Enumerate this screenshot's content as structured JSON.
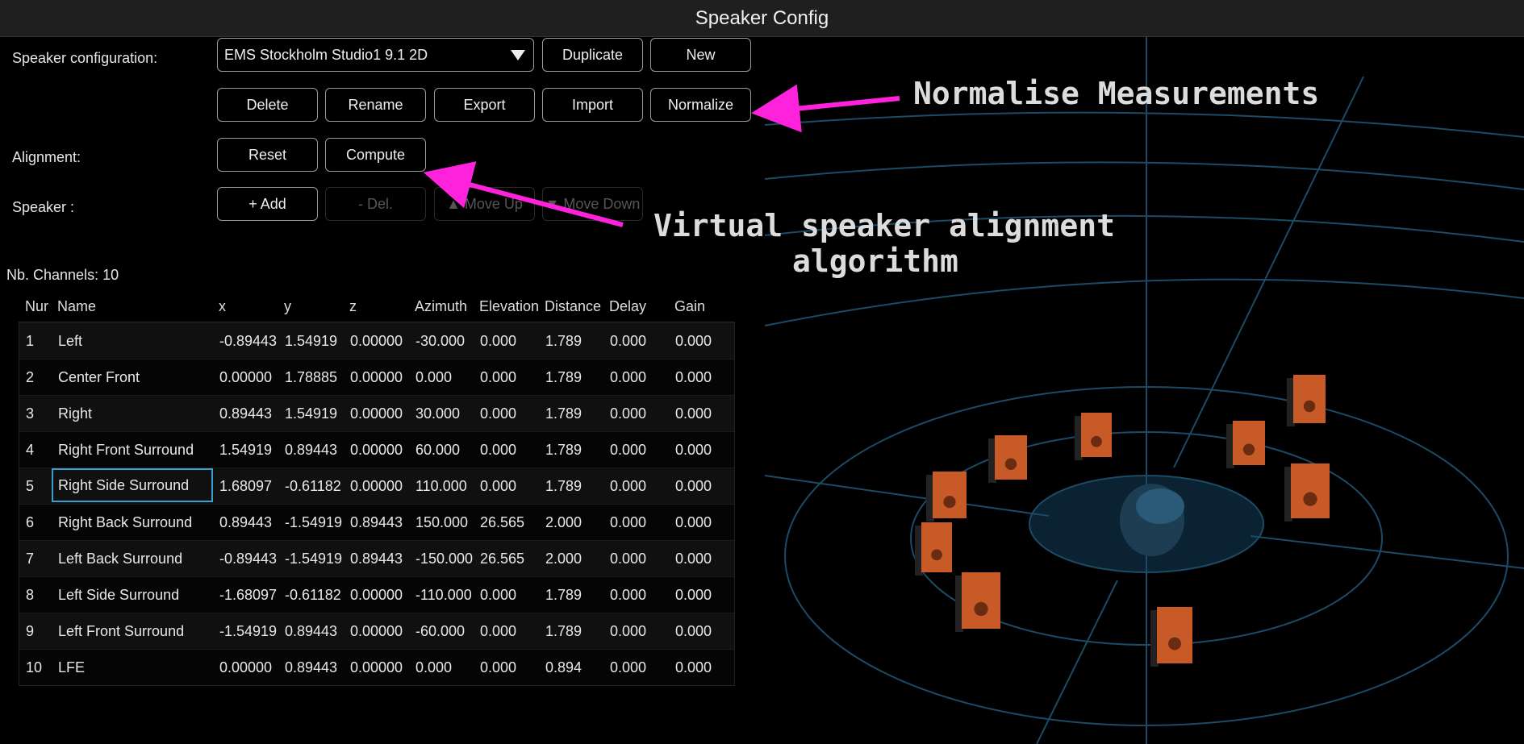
{
  "window": {
    "title": "Speaker Config"
  },
  "config": {
    "label": "Speaker configuration:",
    "selected": "EMS Stockholm Studio1 9.1 2D",
    "buttons": {
      "duplicate": "Duplicate",
      "new": "New",
      "delete": "Delete",
      "rename": "Rename",
      "export": "Export",
      "import": "Import",
      "normalize": "Normalize"
    }
  },
  "alignment": {
    "label": "Alignment:",
    "reset": "Reset",
    "compute": "Compute"
  },
  "speaker": {
    "label": "Speaker :",
    "add": "+ Add",
    "del": "- Del.",
    "move_up": "▲ Move Up",
    "move_down": "▼ Move Down"
  },
  "channels": {
    "label": "Nb. Channels: 10"
  },
  "table": {
    "headers": [
      "Nur",
      "Name",
      "x",
      "y",
      "z",
      "Azimuth",
      "Elevation",
      "Distance",
      "Delay",
      "Gain"
    ],
    "rows": [
      [
        "1",
        "Left",
        "-0.89443",
        "1.54919",
        "0.00000",
        "-30.000",
        "0.000",
        "1.789",
        "0.000",
        "0.000"
      ],
      [
        "2",
        "Center Front",
        "0.00000",
        "1.78885",
        "0.00000",
        "0.000",
        "0.000",
        "1.789",
        "0.000",
        "0.000"
      ],
      [
        "3",
        "Right",
        "0.89443",
        "1.54919",
        "0.00000",
        "30.000",
        "0.000",
        "1.789",
        "0.000",
        "0.000"
      ],
      [
        "4",
        "Right Front Surround",
        "1.54919",
        "0.89443",
        "0.00000",
        "60.000",
        "0.000",
        "1.789",
        "0.000",
        "0.000"
      ],
      [
        "5",
        "Right Side Surround",
        "1.68097",
        "-0.61182",
        "0.00000",
        "110.000",
        "0.000",
        "1.789",
        "0.000",
        "0.000"
      ],
      [
        "6",
        "Right Back Surround",
        "0.89443",
        "-1.54919",
        "0.89443",
        "150.000",
        "26.565",
        "2.000",
        "0.000",
        "0.000"
      ],
      [
        "7",
        "Left Back Surround",
        "-0.89443",
        "-1.54919",
        "0.89443",
        "-150.000",
        "26.565",
        "2.000",
        "0.000",
        "0.000"
      ],
      [
        "8",
        "Left Side Surround",
        "-1.68097",
        "-0.61182",
        "0.00000",
        "-110.000",
        "0.000",
        "1.789",
        "0.000",
        "0.000"
      ],
      [
        "9",
        "Left Front Surround",
        "-1.54919",
        "0.89443",
        "0.00000",
        "-60.000",
        "0.000",
        "1.789",
        "0.000",
        "0.000"
      ],
      [
        "10",
        "LFE",
        "0.00000",
        "0.89443",
        "0.00000",
        "0.000",
        "0.000",
        "0.894",
        "0.000",
        "0.000"
      ]
    ],
    "selected_row": 5
  },
  "annotations": {
    "normalise": "Normalise Measurements",
    "alignment_line1": "Virtual speaker alignment",
    "alignment_line2": "algorithm"
  },
  "colors": {
    "annotation_arrow": "#ff22dd",
    "selection": "#3aa0d0",
    "speaker_box": "#c85a28",
    "grid_line": "#1d4a66"
  }
}
